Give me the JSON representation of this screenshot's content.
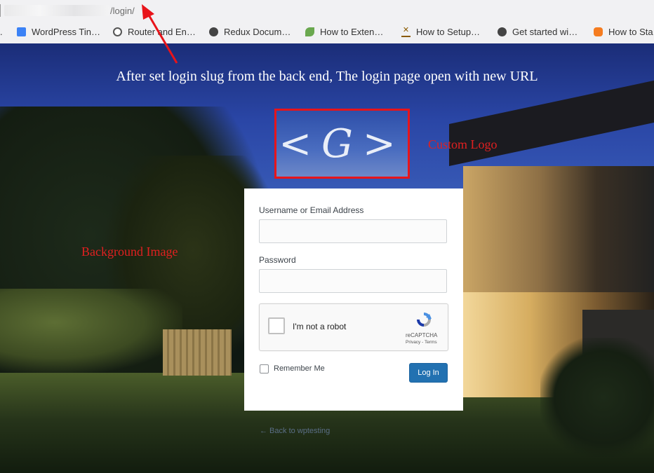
{
  "browser": {
    "url_path": "/login/",
    "bookmarks": [
      {
        "label": "WordPress Tin…",
        "icon": "wordpress-tin-icon",
        "color": "#3b82f6"
      },
      {
        "label": "Router and En…",
        "icon": "wordpress-icon",
        "color": "#555555"
      },
      {
        "label": "Redux Docum…",
        "icon": "globe-icon",
        "color": "#444444"
      },
      {
        "label": "How to Exten…",
        "icon": "leaf-icon",
        "color": "#6aa84f"
      },
      {
        "label": "How to Setup…",
        "icon": "bookmark-x-icon",
        "color": "#8a5a00"
      },
      {
        "label": "Get started wi…",
        "icon": "globe-icon",
        "color": "#444444"
      },
      {
        "label": "How to Sta",
        "icon": "orange-app-icon",
        "color": "#f57c20"
      }
    ],
    "leading_fragment": "."
  },
  "annotations": {
    "top_note": "After set login slug from the back end, The login page open with new URL",
    "logo_note": "Custom Logo",
    "background_note": "Background Image"
  },
  "logo": {
    "text": "<G>"
  },
  "login_form": {
    "username_label": "Username or Email Address",
    "username_value": "",
    "password_label": "Password",
    "password_value": "",
    "recaptcha": {
      "label": "I'm not a robot",
      "brand": "reCAPTCHA",
      "terms": "Privacy - Terms"
    },
    "remember_label": "Remember Me",
    "submit_label": "Log In"
  },
  "back_link": "← Back to wptesting",
  "colors": {
    "annotation_red": "#e02020",
    "logo_border": "#e8141a",
    "button_blue": "#2271b1"
  }
}
